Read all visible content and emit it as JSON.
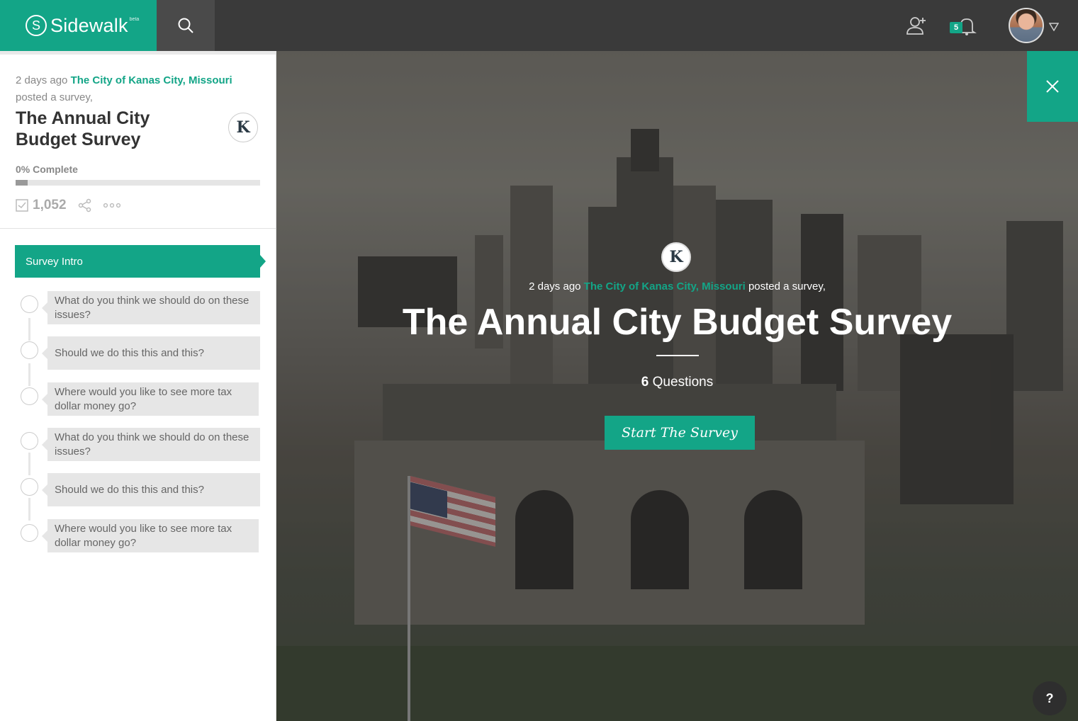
{
  "brand": {
    "name": "Sidewalk",
    "mark": "S",
    "badge": "beta",
    "accent": "#13a587"
  },
  "topbar": {
    "notification_count": "5",
    "avatar_alt": "User avatar"
  },
  "icons": [
    "search-icon",
    "add-user-icon",
    "bell-icon",
    "chevron-down-icon",
    "checkbox-icon",
    "share-icon",
    "more-icon",
    "close-icon"
  ],
  "survey": {
    "time_ago": "2 days ago",
    "org": "The City of Kanas City, Missouri",
    "action": "posted a survey,",
    "title": "The Annual City Budget Survey",
    "org_logo": "K",
    "progress_label": "0% Complete",
    "progress_fraction": 0.05,
    "response_count": "1,052",
    "intro_label": "Survey Intro",
    "question_count": "6",
    "question_word": "Questions",
    "start_label": "Start The Survey"
  },
  "questions": [
    "What do you think we should do on these issues?",
    "Should we do this this and this?",
    "Where would you like to see more tax dollar money go?",
    "What do you think we should do on these issues?",
    "Should we do this this and this?",
    "Where would you like to see more tax dollar money go?"
  ],
  "help_label": "?"
}
